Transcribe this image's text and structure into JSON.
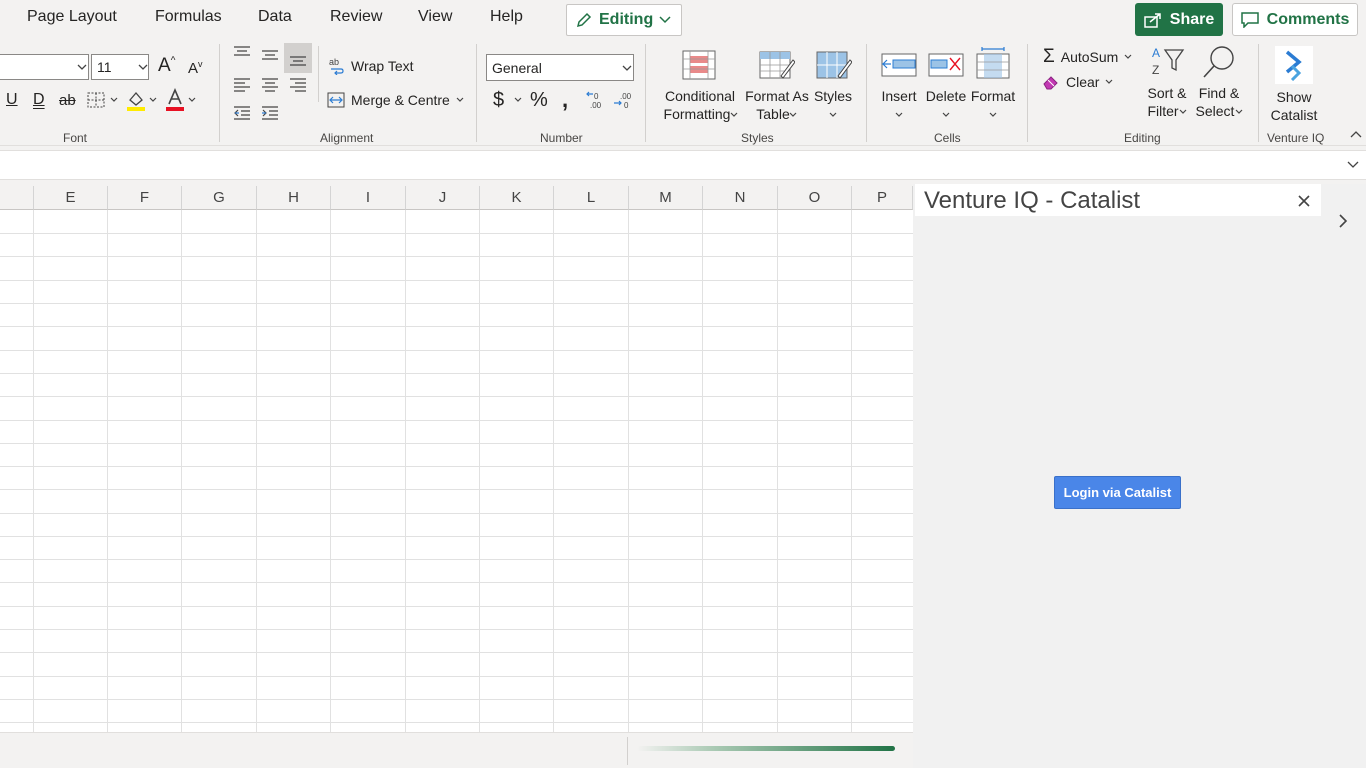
{
  "menu": {
    "items": [
      "Page Layout",
      "Formulas",
      "Data",
      "Review",
      "View",
      "Help"
    ],
    "editing_label": "Editing",
    "share_label": "Share",
    "comments_label": "Comments"
  },
  "font": {
    "size_value": "11",
    "group_label": "Font"
  },
  "alignment": {
    "wrap_text": "Wrap Text",
    "merge_centre": "Merge & Centre",
    "group_label": "Alignment"
  },
  "number": {
    "format_value": "General",
    "group_label": "Number"
  },
  "styles": {
    "conditional_l1": "Conditional",
    "conditional_l2": "Formatting",
    "format_table_l1": "Format As",
    "format_table_l2": "Table",
    "styles_label": "Styles",
    "group_label": "Styles"
  },
  "cells": {
    "insert": "Insert",
    "delete": "Delete",
    "format": "Format",
    "group_label": "Cells"
  },
  "editing": {
    "autosum": "AutoSum",
    "clear": "Clear",
    "sort_l1": "Sort &",
    "sort_l2": "Filter",
    "find_l1": "Find &",
    "find_l2": "Select",
    "group_label": "Editing"
  },
  "venture": {
    "show_l1": "Show",
    "show_l2": "Catalist",
    "group_label": "Venture IQ"
  },
  "grid": {
    "columns": [
      "E",
      "F",
      "G",
      "H",
      "I",
      "J",
      "K",
      "L",
      "M",
      "N",
      "O",
      "P"
    ]
  },
  "pane": {
    "title": "Venture IQ - Catalist",
    "login_label": "Login via Catalist"
  },
  "colors": {
    "accent": "#217346",
    "login_button": "#4a86e8"
  }
}
